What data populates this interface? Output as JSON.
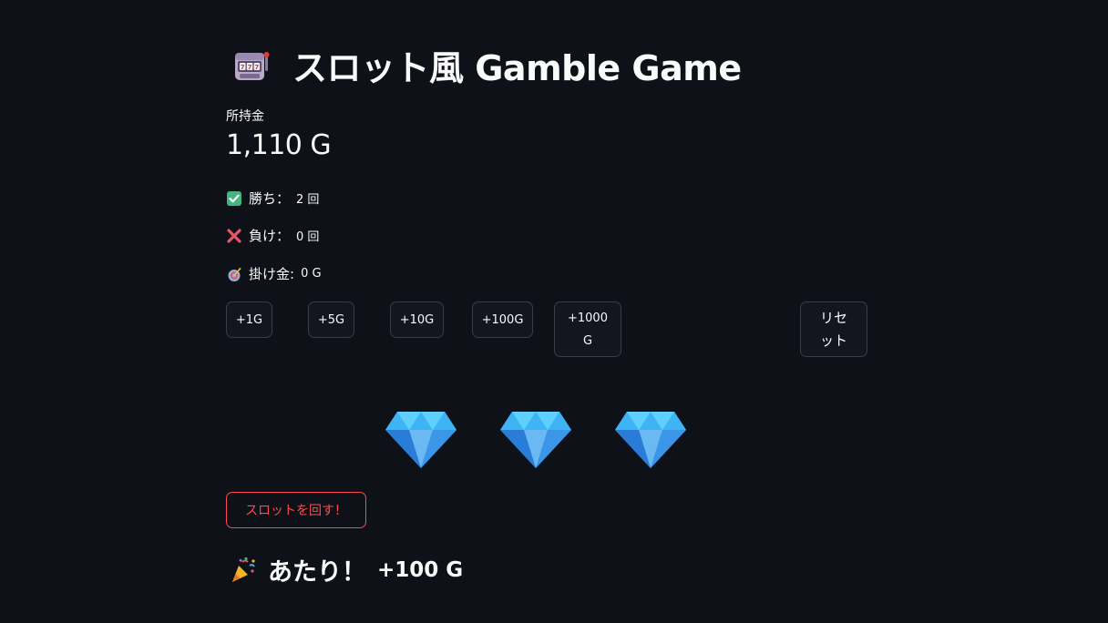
{
  "header": {
    "title": "スロット風 Gamble Game",
    "icon": "slot-machine-icon"
  },
  "balance": {
    "label": "所持金",
    "value": "1,110 G"
  },
  "stats": {
    "wins_label": "勝ち：",
    "wins_value": "2 回",
    "losses_label": "負け：",
    "losses_value": "0 回",
    "bet_label": "掛け金:",
    "bet_value": "0 G"
  },
  "bet_buttons": {
    "add_1": "+1G",
    "add_5": "+5G",
    "add_10": "+10G",
    "add_100": "+100G",
    "add_1000": "+1000 G",
    "reset": "リセット"
  },
  "reels": [
    "gem-icon",
    "gem-icon",
    "gem-icon"
  ],
  "spin_button": "スロットを回す！",
  "result": {
    "message": "あたり！",
    "amount": "+100 G"
  },
  "colors": {
    "background": "#0e1117",
    "accent": "#ff4b4b",
    "text": "#fafafa",
    "button_border": "#3a3d47"
  }
}
